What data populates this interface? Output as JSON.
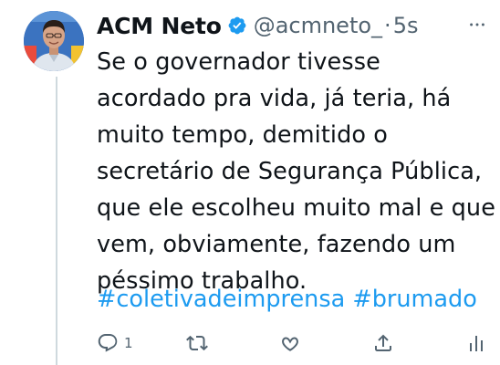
{
  "author": {
    "display_name": "ACM Neto",
    "handle": "@acmneto_",
    "separator": "·",
    "timestamp": "5s",
    "verified": true,
    "avatar_icon": "profile-photo"
  },
  "tweet": {
    "lines": [
      "Se o governador tivesse",
      "acordado pra vida, já teria, há",
      "muito tempo, demitido o",
      "secretário de Segurança Pública,",
      "que ele escolheu muito mal e que",
      "vem, obviamente, fazendo um",
      "péssimo trabalho."
    ],
    "hashtags": [
      "#coletivadeimprensa",
      "#brumado"
    ]
  },
  "actions": {
    "reply_count": "1",
    "reply_icon": "reply-icon",
    "retweet_icon": "retweet-icon",
    "like_icon": "like-icon",
    "share_icon": "share-icon",
    "analytics_icon": "analytics-icon",
    "more_icon": "more-icon"
  },
  "colors": {
    "text": "#0f1419",
    "secondary": "#536471",
    "link": "#1d9bf0",
    "verified": "#1d9bf0",
    "thread_line": "#cfd9de"
  }
}
